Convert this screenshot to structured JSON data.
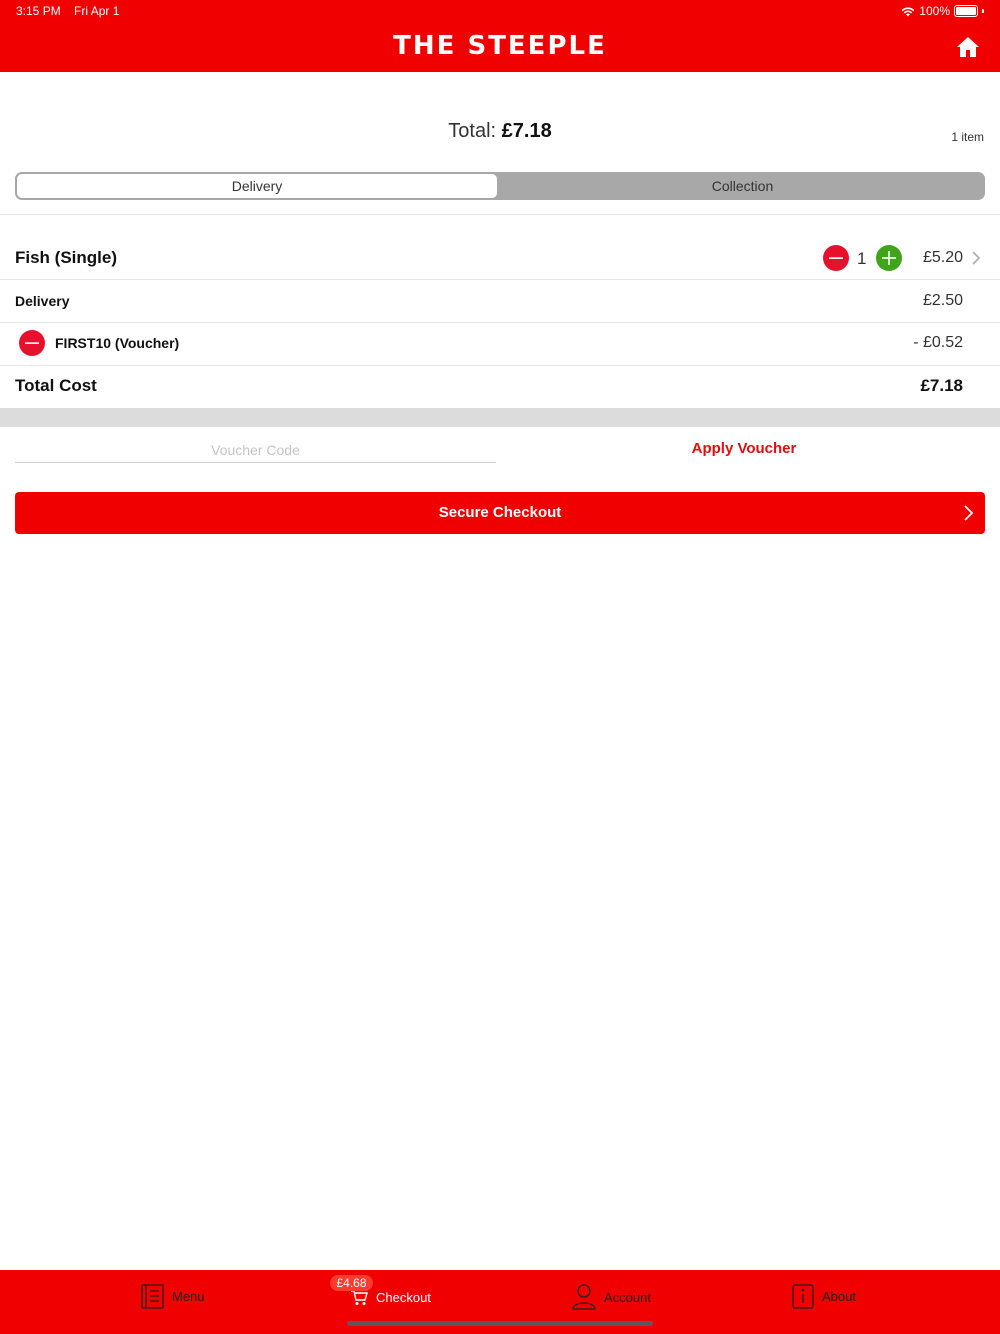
{
  "status": {
    "time": "3:15 PM",
    "date": "Fri Apr 1",
    "battery": "100%"
  },
  "header": {
    "title": "THE STEEPLE",
    "home_icon": "home-icon"
  },
  "summary": {
    "total_label": "Total:",
    "total_value": "£7.18",
    "item_count": "1 item"
  },
  "delivery_mode": {
    "options": [
      "Delivery",
      "Collection"
    ],
    "selected": "Delivery"
  },
  "order": {
    "items": [
      {
        "name": "Fish (Single)",
        "quantity": "1",
        "price": "£5.20"
      }
    ],
    "delivery": {
      "label": "Delivery",
      "price": "£2.50"
    },
    "voucher": {
      "label": "FIRST10 (Voucher)",
      "amount": "- £0.52"
    },
    "total": {
      "label": "Total Cost",
      "value": "£7.18"
    }
  },
  "voucher_entry": {
    "placeholder": "Voucher Code",
    "apply_label": "Apply Voucher"
  },
  "checkout": {
    "label": "Secure Checkout"
  },
  "tabbar": {
    "badge": "£4.68",
    "tabs": [
      {
        "label": "Menu",
        "icon": "menu-book-icon"
      },
      {
        "label": "Checkout",
        "icon": "cart-icon"
      },
      {
        "label": "Account",
        "icon": "person-icon"
      },
      {
        "label": "About",
        "icon": "info-icon"
      }
    ]
  },
  "colors": {
    "brand_red": "#f10000",
    "minus_red": "#e8112d",
    "plus_green": "#3fa41a",
    "apply_red": "#e30d0d"
  }
}
